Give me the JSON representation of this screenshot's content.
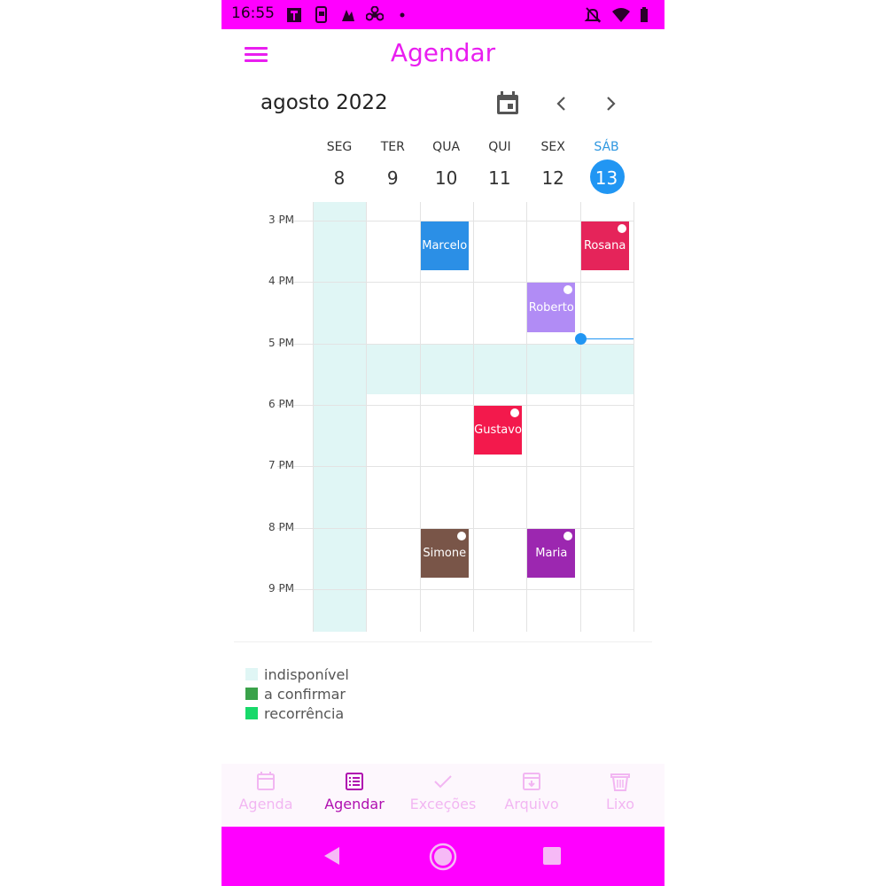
{
  "status_bar": {
    "time": "16:55"
  },
  "app_bar": {
    "title": "Agendar"
  },
  "calendar": {
    "month_label": "agosto 2022",
    "days": [
      {
        "name": "SEG",
        "num": "8"
      },
      {
        "name": "TER",
        "num": "9"
      },
      {
        "name": "QUA",
        "num": "10"
      },
      {
        "name": "QUI",
        "num": "11"
      },
      {
        "name": "SEX",
        "num": "12"
      },
      {
        "name": "SÁB",
        "num": "13",
        "today": true
      }
    ],
    "hours": [
      "3 PM",
      "4 PM",
      "5 PM",
      "6 PM",
      "7 PM",
      "8 PM",
      "9 PM"
    ],
    "events": [
      {
        "name": "Marcelo",
        "day": 2,
        "start": 15.0,
        "end": 15.8,
        "color": "#2b8fe6",
        "dot": false
      },
      {
        "name": "Rosana",
        "day": 5,
        "start": 15.0,
        "end": 15.8,
        "color": "#e5245a",
        "dot": true
      },
      {
        "name": "Roberto",
        "day": 4,
        "start": 16.0,
        "end": 16.8,
        "color": "#b18cf5",
        "dot": true
      },
      {
        "name": "Gustavo",
        "day": 3,
        "start": 18.0,
        "end": 18.8,
        "color": "#f3194c",
        "dot": true
      },
      {
        "name": "Simone",
        "day": 2,
        "start": 20.0,
        "end": 20.8,
        "color": "#795548",
        "dot": true
      },
      {
        "name": "Maria",
        "day": 4,
        "start": 20.0,
        "end": 20.8,
        "color": "#9c27b0",
        "dot": true
      }
    ]
  },
  "legend": [
    {
      "label": "indisponível",
      "color": "#e0f6f5"
    },
    {
      "label": "a confirmar",
      "color": "#3aa24a"
    },
    {
      "label": "recorrência",
      "color": "#18d96a"
    }
  ],
  "bottom_nav": [
    {
      "label": "Agenda",
      "icon": "calendar-icon",
      "active": false
    },
    {
      "label": "Agendar",
      "icon": "list-icon",
      "active": true
    },
    {
      "label": "Exceções",
      "icon": "check-icon",
      "active": false
    },
    {
      "label": "Arquivo",
      "icon": "archive-icon",
      "active": false
    },
    {
      "label": "Lixo",
      "icon": "trash-icon",
      "active": false
    }
  ],
  "colors": {
    "accent": "#ff00ff",
    "title": "#e91ef0",
    "today": "#2196f3",
    "unavailable": "#e0f6f5"
  }
}
